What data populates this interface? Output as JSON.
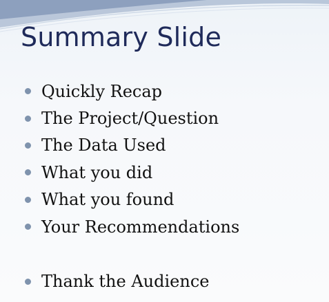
{
  "slide": {
    "title": "Summary Slide",
    "bullets": [
      "Quickly Recap",
      "The Project/Question",
      "The Data Used",
      "What you did",
      "What you found",
      "Your Recommendations"
    ],
    "closing_bullet": "Thank the Audience"
  },
  "colors": {
    "title": "#1f2a5a",
    "bullet_marker": "#7f93ad",
    "text": "#111111",
    "swoosh": "#7f95b6"
  }
}
